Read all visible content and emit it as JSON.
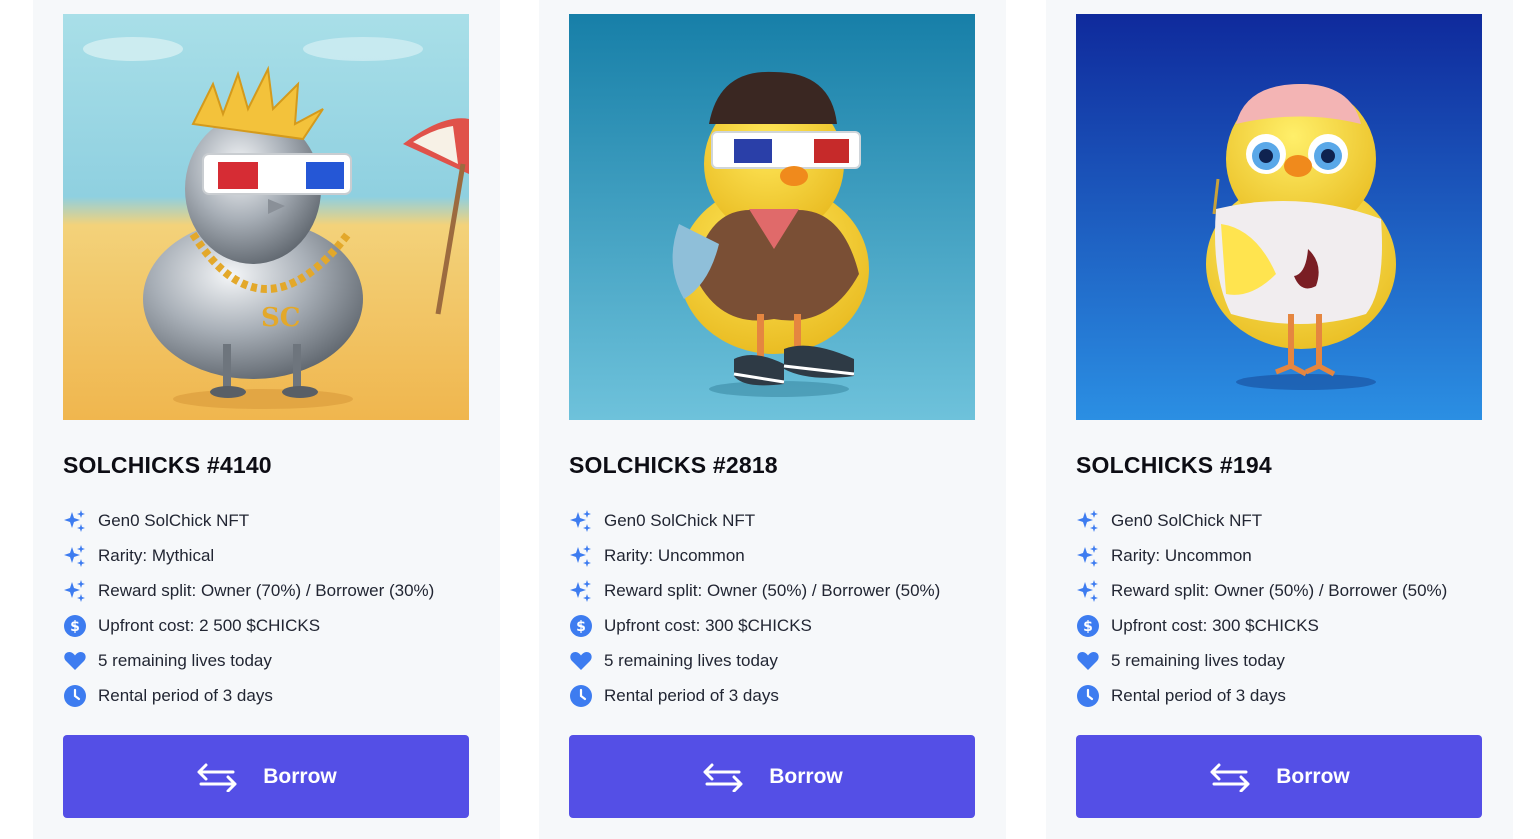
{
  "colors": {
    "accent": "#544fe6",
    "icon_blue": "#3d7cf0",
    "card_bg": "#f6f8fa"
  },
  "cards": [
    {
      "title": "SOLCHICKS #4140",
      "image_name": "silver-chick-beach-image",
      "features": [
        {
          "icon": "sparkle-icon",
          "text": "Gen0 SolChick NFT"
        },
        {
          "icon": "sparkle-icon",
          "text": "Rarity: Mythical"
        },
        {
          "icon": "sparkle-icon",
          "text": "Reward split: Owner (70%) / Borrower (30%)"
        },
        {
          "icon": "dollar-icon",
          "text": "Upfront cost: 2 500 $CHICKS"
        },
        {
          "icon": "heart-icon",
          "text": "5 remaining lives today"
        },
        {
          "icon": "clock-icon",
          "text": "Rental period of 3 days"
        }
      ],
      "button_label": "Borrow"
    },
    {
      "title": "SOLCHICKS #2818",
      "image_name": "yellow-chick-vest-image",
      "features": [
        {
          "icon": "sparkle-icon",
          "text": "Gen0 SolChick NFT"
        },
        {
          "icon": "sparkle-icon",
          "text": "Rarity: Uncommon"
        },
        {
          "icon": "sparkle-icon",
          "text": "Reward split: Owner (50%) / Borrower (50%)"
        },
        {
          "icon": "dollar-icon",
          "text": "Upfront cost: 300 $CHICKS"
        },
        {
          "icon": "heart-icon",
          "text": "5 remaining lives today"
        },
        {
          "icon": "clock-icon",
          "text": "Rental period of 3 days"
        }
      ],
      "button_label": "Borrow"
    },
    {
      "title": "SOLCHICKS #194",
      "image_name": "yellow-chick-jersey-image",
      "features": [
        {
          "icon": "sparkle-icon",
          "text": "Gen0 SolChick NFT"
        },
        {
          "icon": "sparkle-icon",
          "text": "Rarity: Uncommon"
        },
        {
          "icon": "sparkle-icon",
          "text": "Reward split: Owner (50%) / Borrower (50%)"
        },
        {
          "icon": "dollar-icon",
          "text": "Upfront cost: 300 $CHICKS"
        },
        {
          "icon": "heart-icon",
          "text": "5 remaining lives today"
        },
        {
          "icon": "clock-icon",
          "text": "Rental period of 3 days"
        }
      ],
      "button_label": "Borrow"
    }
  ]
}
